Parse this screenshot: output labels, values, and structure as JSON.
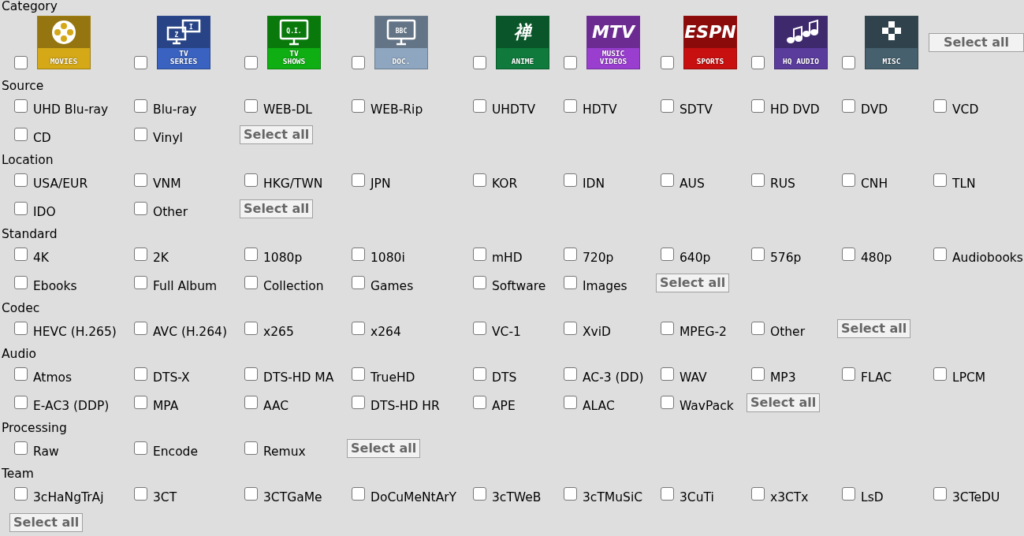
{
  "category": {
    "title": "Category",
    "items": [
      {
        "checked": false,
        "kind": "reel",
        "color": "#d4a817",
        "label_lines": [
          "MOVIES"
        ]
      },
      {
        "checked": false,
        "kind": "monitors",
        "color": "#3a62c0",
        "label_lines": [
          "TV",
          "SERIES"
        ],
        "screen_texts": [
          "Z",
          "I"
        ]
      },
      {
        "checked": false,
        "kind": "monitor",
        "color": "#0fae12",
        "label_lines": [
          "TV",
          "SHOWS"
        ],
        "screen_texts": [
          "Q.I."
        ]
      },
      {
        "checked": false,
        "kind": "monitor",
        "color": "#8ea6c0",
        "label_lines": [
          "DOC."
        ],
        "screen_texts": [
          "BBC"
        ]
      },
      {
        "checked": false,
        "kind": "glyph",
        "color": "#0f7a3c",
        "label_lines": [
          "ANIME"
        ],
        "glyph": "禅"
      },
      {
        "checked": false,
        "kind": "glyph",
        "color": "#9a3ed0",
        "label_lines": [
          "MUSIC",
          "VIDEOS"
        ],
        "glyph": "MTV"
      },
      {
        "checked": false,
        "kind": "glyph",
        "color": "#c81010",
        "label_lines": [
          "SPORTS"
        ],
        "glyph": "ESPN"
      },
      {
        "checked": false,
        "kind": "notes",
        "color": "#5a3c9c",
        "label_lines": [
          "HQ AUDIO"
        ]
      },
      {
        "checked": false,
        "kind": "dpad",
        "color": "#46606e",
        "label_lines": [
          "MISC"
        ]
      }
    ],
    "select_all": "Select all"
  },
  "sections": [
    {
      "title": "Source",
      "options": [
        {
          "label": "UHD Blu-ray",
          "checked": false
        },
        {
          "label": "Blu-ray",
          "checked": false
        },
        {
          "label": "WEB-DL",
          "checked": false
        },
        {
          "label": "WEB-Rip",
          "checked": false
        },
        {
          "label": "UHDTV",
          "checked": false
        },
        {
          "label": "HDTV",
          "checked": false
        },
        {
          "label": "SDTV",
          "checked": false
        },
        {
          "label": "HD DVD",
          "checked": false
        },
        {
          "label": "DVD",
          "checked": false
        },
        {
          "label": "VCD",
          "checked": false
        },
        {
          "label": "CD",
          "checked": false
        },
        {
          "label": "Vinyl",
          "checked": false
        }
      ],
      "select_all": "Select all"
    },
    {
      "title": "Location",
      "options": [
        {
          "label": "USA/EUR",
          "checked": false
        },
        {
          "label": "VNM",
          "checked": false
        },
        {
          "label": "HKG/TWN",
          "checked": false
        },
        {
          "label": "JPN",
          "checked": false
        },
        {
          "label": "KOR",
          "checked": false
        },
        {
          "label": "IDN",
          "checked": false
        },
        {
          "label": "AUS",
          "checked": false
        },
        {
          "label": "RUS",
          "checked": false
        },
        {
          "label": "CNH",
          "checked": false
        },
        {
          "label": "TLN",
          "checked": false
        },
        {
          "label": "IDO",
          "checked": false
        },
        {
          "label": "Other",
          "checked": false
        }
      ],
      "select_all": "Select all"
    },
    {
      "title": "Standard",
      "options": [
        {
          "label": "4K",
          "checked": false
        },
        {
          "label": "2K",
          "checked": false
        },
        {
          "label": "1080p",
          "checked": false
        },
        {
          "label": "1080i",
          "checked": false
        },
        {
          "label": "mHD",
          "checked": false
        },
        {
          "label": "720p",
          "checked": false
        },
        {
          "label": "640p",
          "checked": false
        },
        {
          "label": "576p",
          "checked": false
        },
        {
          "label": "480p",
          "checked": false
        },
        {
          "label": "Audiobooks",
          "checked": false
        },
        {
          "label": "Ebooks",
          "checked": false
        },
        {
          "label": "Full Album",
          "checked": false
        },
        {
          "label": "Collection",
          "checked": false
        },
        {
          "label": "Games",
          "checked": false
        },
        {
          "label": "Software",
          "checked": false
        },
        {
          "label": "Images",
          "checked": false
        }
      ],
      "select_all": "Select all"
    },
    {
      "title": "Codec",
      "options": [
        {
          "label": "HEVC (H.265)",
          "checked": false
        },
        {
          "label": "AVC (H.264)",
          "checked": false
        },
        {
          "label": "x265",
          "checked": false
        },
        {
          "label": "x264",
          "checked": false
        },
        {
          "label": "VC-1",
          "checked": false
        },
        {
          "label": "XviD",
          "checked": false
        },
        {
          "label": "MPEG-2",
          "checked": false
        },
        {
          "label": "Other",
          "checked": false
        }
      ],
      "select_all": "Select all"
    },
    {
      "title": "Audio",
      "options": [
        {
          "label": "Atmos",
          "checked": false
        },
        {
          "label": "DTS-X",
          "checked": false
        },
        {
          "label": "DTS-HD MA",
          "checked": false
        },
        {
          "label": "TrueHD",
          "checked": false
        },
        {
          "label": "DTS",
          "checked": false
        },
        {
          "label": "AC-3 (DD)",
          "checked": false
        },
        {
          "label": "WAV",
          "checked": false
        },
        {
          "label": "MP3",
          "checked": false
        },
        {
          "label": "FLAC",
          "checked": false
        },
        {
          "label": "LPCM",
          "checked": false
        },
        {
          "label": "E-AC3 (DDP)",
          "checked": false
        },
        {
          "label": "MPA",
          "checked": false
        },
        {
          "label": "AAC",
          "checked": false
        },
        {
          "label": "DTS-HD HR",
          "checked": false
        },
        {
          "label": "APE",
          "checked": false
        },
        {
          "label": "ALAC",
          "checked": false
        },
        {
          "label": "WavPack",
          "checked": false
        }
      ],
      "select_all": "Select all"
    },
    {
      "title": "Processing",
      "options": [
        {
          "label": "Raw",
          "checked": false
        },
        {
          "label": "Encode",
          "checked": false
        },
        {
          "label": "Remux",
          "checked": false
        }
      ],
      "select_all": "Select all"
    },
    {
      "title": "Team",
      "options": [
        {
          "label": "3cHaNgTrAj",
          "checked": false
        },
        {
          "label": "3CT",
          "checked": false
        },
        {
          "label": "3CTGaMe",
          "checked": false
        },
        {
          "label": "DoCuMeNtArY",
          "checked": false
        },
        {
          "label": "3cTWeB",
          "checked": false
        },
        {
          "label": "3cTMuSiC",
          "checked": false
        },
        {
          "label": "3CuTi",
          "checked": false
        },
        {
          "label": "x3CTx",
          "checked": false
        },
        {
          "label": "LsD",
          "checked": false
        },
        {
          "label": "3CTeDU",
          "checked": false
        }
      ],
      "select_all": "Select all"
    }
  ]
}
